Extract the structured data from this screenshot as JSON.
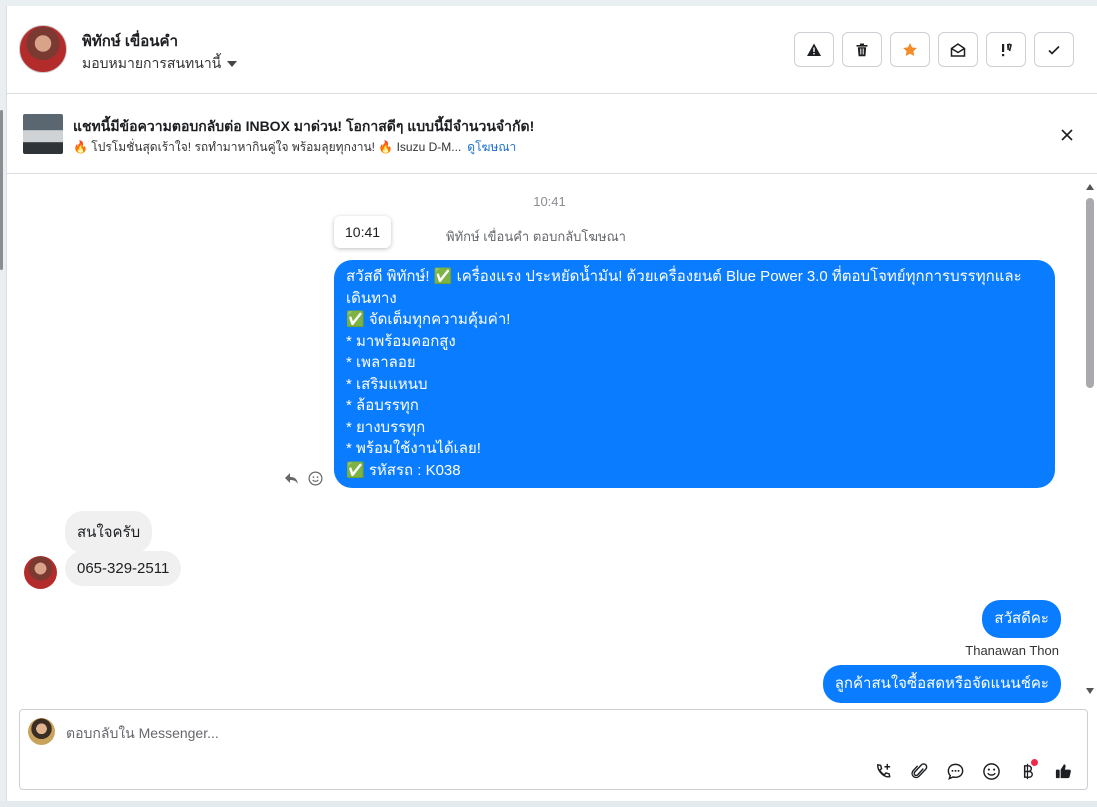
{
  "header": {
    "contact_name": "พิทักษ์ เขื่อนคำ",
    "assign_label": "มอบหมายการสนทนานี้",
    "actions": [
      {
        "icon": "warning-icon"
      },
      {
        "icon": "trash-icon"
      },
      {
        "icon": "star-icon",
        "color": "#f28c28"
      },
      {
        "icon": "envelope-open-icon"
      },
      {
        "icon": "priority-icon"
      },
      {
        "icon": "check-icon"
      }
    ]
  },
  "ad": {
    "title": "แชทนี้มีข้อความตอบกลับต่อ INBOX มาด่วน! โอกาสดีๆ แบบนี้มีจำนวนจำกัด!",
    "subtitle": "🔥 โปรโมชั่นสุดเร้าใจ! รถทำมาหากินคู่ใจ พร้อมลุยทุกงาน! 🔥 Isuzu D-M...",
    "link": "ดูโฆษณา"
  },
  "conversation": {
    "time_center": "10:41",
    "tooltip_time": "10:41",
    "reply_note": "พิทักษ์ เขื่อนคำ ตอบกลับโฆษณา",
    "ad_message": "สวัสดี พิทักษ์! ✅ เครื่องแรง ประหยัดน้ำมัน! ด้วยเครื่องยนต์ Blue Power 3.0 ที่ตอบโจทย์ทุกการบรรทุกและเดินทาง\n✅ จัดเต็มทุกความคุ้มค่า!\n* มาพร้อมคอกสูง\n* เพลาลอย\n* เสริมแหนบ\n* ล้อบรรทุก\n* ยางบรรทุก\n* พร้อมใช้งานได้เลย!\n✅ รหัสรถ : K038",
    "incoming": [
      "สนใจครับ",
      "065-329-2511"
    ],
    "outgoing": [
      "สวัสดีคะ",
      "ลูกค้าสนใจซื้อสดหรือจัดแนนช์คะ"
    ],
    "sender_name": "Thanawan Thon"
  },
  "composer": {
    "placeholder": "ตอบกลับใน Messenger...",
    "tools": [
      "phone-add-icon",
      "paperclip-icon",
      "chat-bubble-icon",
      "emoji-icon",
      "baht-icon",
      "thumbs-up-icon"
    ]
  },
  "colors": {
    "outgoing_bubble": "#0a7cff",
    "incoming_bubble": "#f0f0f0",
    "star": "#f28c28",
    "link": "#1a6fd1",
    "notification_dot": "#f02849"
  }
}
